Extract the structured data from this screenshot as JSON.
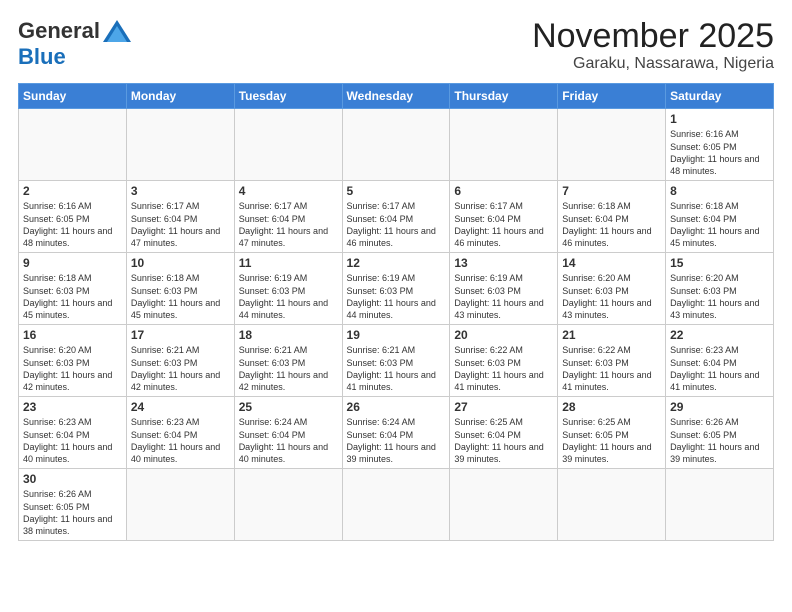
{
  "logo": {
    "general": "General",
    "blue": "Blue"
  },
  "title": "November 2025",
  "subtitle": "Garaku, Nassarawa, Nigeria",
  "days": [
    "Sunday",
    "Monday",
    "Tuesday",
    "Wednesday",
    "Thursday",
    "Friday",
    "Saturday"
  ],
  "weeks": [
    [
      {
        "day": "",
        "text": ""
      },
      {
        "day": "",
        "text": ""
      },
      {
        "day": "",
        "text": ""
      },
      {
        "day": "",
        "text": ""
      },
      {
        "day": "",
        "text": ""
      },
      {
        "day": "",
        "text": ""
      },
      {
        "day": "1",
        "text": "Sunrise: 6:16 AM\nSunset: 6:05 PM\nDaylight: 11 hours\nand 48 minutes."
      }
    ],
    [
      {
        "day": "2",
        "text": "Sunrise: 6:16 AM\nSunset: 6:05 PM\nDaylight: 11 hours\nand 48 minutes."
      },
      {
        "day": "3",
        "text": "Sunrise: 6:17 AM\nSunset: 6:04 PM\nDaylight: 11 hours\nand 47 minutes."
      },
      {
        "day": "4",
        "text": "Sunrise: 6:17 AM\nSunset: 6:04 PM\nDaylight: 11 hours\nand 47 minutes."
      },
      {
        "day": "5",
        "text": "Sunrise: 6:17 AM\nSunset: 6:04 PM\nDaylight: 11 hours\nand 46 minutes."
      },
      {
        "day": "6",
        "text": "Sunrise: 6:17 AM\nSunset: 6:04 PM\nDaylight: 11 hours\nand 46 minutes."
      },
      {
        "day": "7",
        "text": "Sunrise: 6:18 AM\nSunset: 6:04 PM\nDaylight: 11 hours\nand 46 minutes."
      },
      {
        "day": "8",
        "text": "Sunrise: 6:18 AM\nSunset: 6:04 PM\nDaylight: 11 hours\nand 45 minutes."
      }
    ],
    [
      {
        "day": "9",
        "text": "Sunrise: 6:18 AM\nSunset: 6:03 PM\nDaylight: 11 hours\nand 45 minutes."
      },
      {
        "day": "10",
        "text": "Sunrise: 6:18 AM\nSunset: 6:03 PM\nDaylight: 11 hours\nand 45 minutes."
      },
      {
        "day": "11",
        "text": "Sunrise: 6:19 AM\nSunset: 6:03 PM\nDaylight: 11 hours\nand 44 minutes."
      },
      {
        "day": "12",
        "text": "Sunrise: 6:19 AM\nSunset: 6:03 PM\nDaylight: 11 hours\nand 44 minutes."
      },
      {
        "day": "13",
        "text": "Sunrise: 6:19 AM\nSunset: 6:03 PM\nDaylight: 11 hours\nand 43 minutes."
      },
      {
        "day": "14",
        "text": "Sunrise: 6:20 AM\nSunset: 6:03 PM\nDaylight: 11 hours\nand 43 minutes."
      },
      {
        "day": "15",
        "text": "Sunrise: 6:20 AM\nSunset: 6:03 PM\nDaylight: 11 hours\nand 43 minutes."
      }
    ],
    [
      {
        "day": "16",
        "text": "Sunrise: 6:20 AM\nSunset: 6:03 PM\nDaylight: 11 hours\nand 42 minutes."
      },
      {
        "day": "17",
        "text": "Sunrise: 6:21 AM\nSunset: 6:03 PM\nDaylight: 11 hours\nand 42 minutes."
      },
      {
        "day": "18",
        "text": "Sunrise: 6:21 AM\nSunset: 6:03 PM\nDaylight: 11 hours\nand 42 minutes."
      },
      {
        "day": "19",
        "text": "Sunrise: 6:21 AM\nSunset: 6:03 PM\nDaylight: 11 hours\nand 41 minutes."
      },
      {
        "day": "20",
        "text": "Sunrise: 6:22 AM\nSunset: 6:03 PM\nDaylight: 11 hours\nand 41 minutes."
      },
      {
        "day": "21",
        "text": "Sunrise: 6:22 AM\nSunset: 6:03 PM\nDaylight: 11 hours\nand 41 minutes."
      },
      {
        "day": "22",
        "text": "Sunrise: 6:23 AM\nSunset: 6:04 PM\nDaylight: 11 hours\nand 41 minutes."
      }
    ],
    [
      {
        "day": "23",
        "text": "Sunrise: 6:23 AM\nSunset: 6:04 PM\nDaylight: 11 hours\nand 40 minutes."
      },
      {
        "day": "24",
        "text": "Sunrise: 6:23 AM\nSunset: 6:04 PM\nDaylight: 11 hours\nand 40 minutes."
      },
      {
        "day": "25",
        "text": "Sunrise: 6:24 AM\nSunset: 6:04 PM\nDaylight: 11 hours\nand 40 minutes."
      },
      {
        "day": "26",
        "text": "Sunrise: 6:24 AM\nSunset: 6:04 PM\nDaylight: 11 hours\nand 39 minutes."
      },
      {
        "day": "27",
        "text": "Sunrise: 6:25 AM\nSunset: 6:04 PM\nDaylight: 11 hours\nand 39 minutes."
      },
      {
        "day": "28",
        "text": "Sunrise: 6:25 AM\nSunset: 6:05 PM\nDaylight: 11 hours\nand 39 minutes."
      },
      {
        "day": "29",
        "text": "Sunrise: 6:26 AM\nSunset: 6:05 PM\nDaylight: 11 hours\nand 39 minutes."
      }
    ],
    [
      {
        "day": "30",
        "text": "Sunrise: 6:26 AM\nSunset: 6:05 PM\nDaylight: 11 hours\nand 38 minutes."
      },
      {
        "day": "",
        "text": ""
      },
      {
        "day": "",
        "text": ""
      },
      {
        "day": "",
        "text": ""
      },
      {
        "day": "",
        "text": ""
      },
      {
        "day": "",
        "text": ""
      },
      {
        "day": "",
        "text": ""
      }
    ]
  ]
}
